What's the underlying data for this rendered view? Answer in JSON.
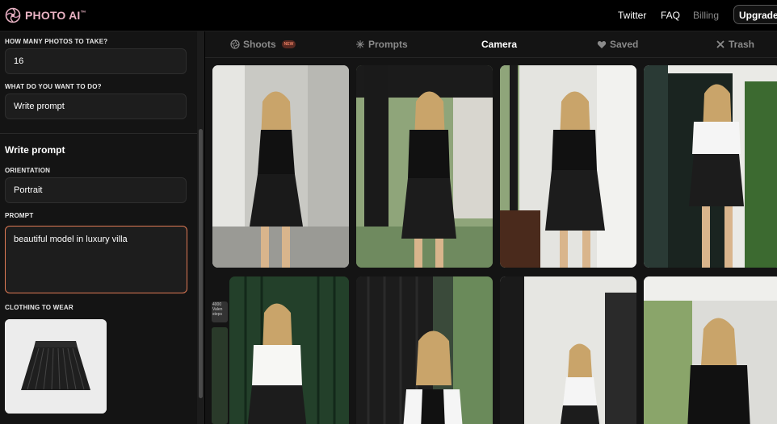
{
  "app": {
    "logo_text": "PHOTO AI",
    "logo_mark": "™"
  },
  "topnav": {
    "twitter": "Twitter",
    "faq": "FAQ",
    "billing": "Billing",
    "upgrade": "Upgrade"
  },
  "sidebar": {
    "photos_count_label": "HOW MANY PHOTOS TO TAKE?",
    "photos_count_value": "16",
    "action_label": "WHAT DO YOU WANT TO DO?",
    "action_value": "Write prompt",
    "section_title": "Write prompt",
    "orientation_label": "ORIENTATION",
    "orientation_value": "Portrait",
    "prompt_label": "PROMPT",
    "prompt_value": "beautiful model in luxury villa",
    "clothing_label": "CLOTHING TO WEAR"
  },
  "tabs": [
    {
      "label": "Shoots",
      "icon": "aperture-icon",
      "badge": "NEW"
    },
    {
      "label": "Prompts",
      "icon": "sparkle-icon"
    },
    {
      "label": "Camera",
      "icon": ""
    },
    {
      "label": "Saved",
      "icon": "heart-icon"
    },
    {
      "label": "Trash",
      "icon": "x-icon"
    }
  ],
  "peek_text": "4000 Valen steps",
  "colors": {
    "accent": "#e07a55",
    "logo": "#e8b2c3",
    "background": "#000000",
    "panel": "#141414"
  }
}
